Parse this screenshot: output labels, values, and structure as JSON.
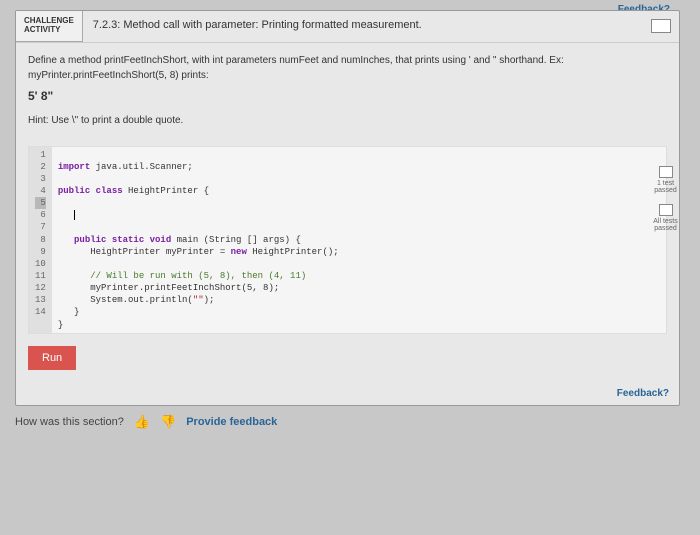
{
  "feedback_top": "Feedback?",
  "challenge_tag_line1": "CHALLENGE",
  "challenge_tag_line2": "ACTIVITY",
  "challenge_title": "7.2.3: Method call with parameter: Printing formatted measurement.",
  "desc_line1": "Define a method printFeetInchShort, with int parameters numFeet and numInches, that prints using ' and \" shorthand. Ex:",
  "desc_line2": "myPrinter.printFeetInchShort(5, 8) prints:",
  "example_output": "5' 8\"",
  "hint": "Hint: Use \\\" to print a double quote.",
  "code": {
    "l1": "import java.util.Scanner;",
    "l2": "",
    "l3": "public class HeightPrinter {",
    "l4": "",
    "l5": "   |",
    "l6": "",
    "l7": "   public static void main (String [] args) {",
    "l8": "      HeightPrinter myPrinter = new HeightPrinter();",
    "l9": "",
    "l10": "      // Will be run with (5, 8), then (4, 11)",
    "l11": "      myPrinter.printFeetInchShort(5, 8);",
    "l12": "      System.out.println(\"\");",
    "l13": "   }",
    "l14": "}"
  },
  "status1_label": "1 test\npassed",
  "status2_label": "All tests\npassed",
  "run_label": "Run",
  "feedback_bottom": "Feedback?",
  "section_q": "How was this section?",
  "provide": "Provide feedback"
}
